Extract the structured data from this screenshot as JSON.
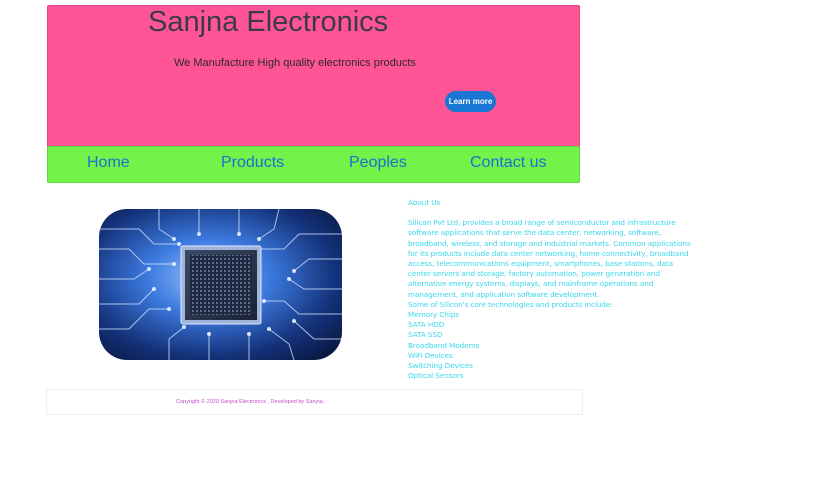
{
  "header": {
    "title": "Sanjna Electronics",
    "tagline": "We Manufacture High quality electronics  products",
    "learn_more_label": "Learn more"
  },
  "nav": {
    "items": [
      {
        "label": "Home"
      },
      {
        "label": "Products"
      },
      {
        "label": "Peoples"
      },
      {
        "label": "Contact us"
      }
    ]
  },
  "about": {
    "heading": "About Us",
    "body": "Silicon Pvt Ltd, provides a broad range of semiconductor and infrastructure software applications that serve the data center, networking, software, broadband, wireless, and storage and industrial markets. Common applications for its products include data center networking, home connectivity, broadband access, telecommunications equipment, smartphones, base stations, data center servers and storage, factory automation, power generation and alternative energy systems, displays, and mainframe operations and management, and application software development.",
    "list_intro": "Some of Silicon's core technologies and products include:",
    "products": [
      "Memory Chips",
      "SATA HDD",
      "SATA SSD",
      "Broadband Modems",
      "WiFi Devices",
      "Switching Devices",
      "Optical Sensors"
    ]
  },
  "footer": {
    "copyright": "Copyright © 2020 Sanjna Electronics , Developed by Sanjna."
  },
  "colors": {
    "hero_bg": "#ff5596",
    "nav_bg": "#73f24a",
    "nav_link": "#1c6fd1",
    "button_bg": "#1976d2",
    "about_text": "#3bd8ec",
    "footer_text": "#c24fc8"
  }
}
